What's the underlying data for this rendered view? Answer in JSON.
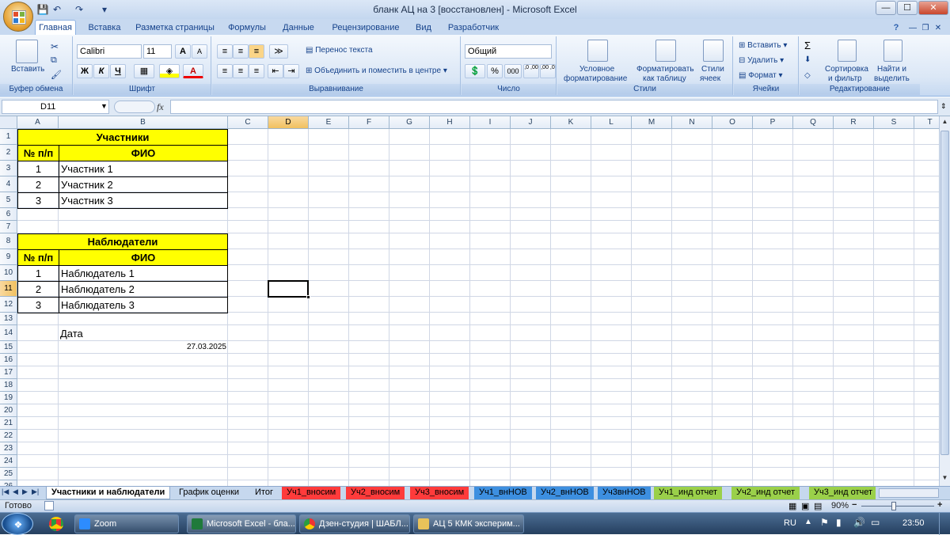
{
  "window": {
    "title": "бланк АЦ на 3 [восстановлен] - Microsoft Excel",
    "min": "—",
    "max": "☐",
    "close": "✕",
    "ribbon_min": "—",
    "ribbon_restore": "❐",
    "ribbon_close": "✕"
  },
  "tabs": [
    "Главная",
    "Вставка",
    "Разметка страницы",
    "Формулы",
    "Данные",
    "Рецензирование",
    "Вид",
    "Разработчик"
  ],
  "help_icon": "?",
  "ribbon": {
    "clipboard": {
      "paste": "Вставить",
      "label": "Буфер обмена"
    },
    "font": {
      "name": "Calibri",
      "size": "11",
      "bold": "Ж",
      "italic": "К",
      "underline": "Ч",
      "grow": "A",
      "shrink": "A",
      "color_letter": "A",
      "label": "Шрифт"
    },
    "alignment": {
      "wrap": "Перенос текста",
      "merge": "Объединить и поместить в центре",
      "label": "Выравнивание"
    },
    "number": {
      "format": "Общий",
      "percent": "%",
      "thousands": "000",
      "inc": ",0 ,00",
      "dec": ",00 ,0",
      "label": "Число"
    },
    "styles": {
      "conditional": "Условное",
      "conditional2": "форматирование",
      "table": "Форматировать",
      "table2": "как таблицу",
      "cell": "Стили",
      "cell2": "ячеек",
      "label": "Стили"
    },
    "cells": {
      "insert": "Вставить",
      "delete": "Удалить",
      "format": "Формат",
      "label": "Ячейки"
    },
    "editing": {
      "sigma": "Σ",
      "sort": "Сортировка",
      "sort2": "и фильтр",
      "find": "Найти и",
      "find2": "выделить",
      "label": "Редактирование"
    }
  },
  "formula_bar": {
    "name_box": "D11",
    "fx": "fx",
    "content": ""
  },
  "columns": [
    "A",
    "B",
    "C",
    "D",
    "E",
    "F",
    "G",
    "H",
    "I",
    "J",
    "K",
    "L",
    "M",
    "N",
    "O",
    "P",
    "Q",
    "R",
    "S",
    "T"
  ],
  "rows": [
    "1",
    "2",
    "3",
    "4",
    "5",
    "6",
    "7",
    "8",
    "9",
    "10",
    "11",
    "12",
    "13",
    "14",
    "15",
    "16",
    "17",
    "18",
    "19",
    "20",
    "21",
    "22",
    "23",
    "24",
    "25",
    "26"
  ],
  "cells": {
    "b1": "Участники",
    "a2": "№ п/п",
    "b2": "ФИО",
    "participants": [
      {
        "n": "1",
        "name": "Участник 1"
      },
      {
        "n": "2",
        "name": "Участник 2"
      },
      {
        "n": "3",
        "name": "Участник 3"
      }
    ],
    "b8": "Наблюдатели",
    "a9": "№ п/п",
    "b9": "ФИО",
    "observers": [
      {
        "n": "1",
        "name": "Наблюдатель 1"
      },
      {
        "n": "2",
        "name": "Наблюдатель 2"
      },
      {
        "n": "3",
        "name": "Наблюдатель 3"
      }
    ],
    "b14": "Дата",
    "b15": "27.03.2025"
  },
  "sheet_tabs": [
    {
      "label": "Участники и наблюдатели",
      "color": "#ffffff"
    },
    {
      "label": "График оценки",
      "color": "#c6d8ee"
    },
    {
      "label": "Итог",
      "color": "#c6d8ee"
    },
    {
      "label": "Уч1_вносим",
      "color": "#ff3b3b"
    },
    {
      "label": "Уч2_вносим",
      "color": "#ff3b3b"
    },
    {
      "label": "Уч3_вносим",
      "color": "#ff3b3b"
    },
    {
      "label": "Уч1_внНОВ",
      "color": "#3d8fe0"
    },
    {
      "label": "Уч2_внНОВ",
      "color": "#3d8fe0"
    },
    {
      "label": "Уч3внНОВ",
      "color": "#3d8fe0"
    },
    {
      "label": "Уч1_инд отчет",
      "color": "#9ad04a"
    },
    {
      "label": "Уч2_инд отчет",
      "color": "#9ad04a"
    },
    {
      "label": "Уч3_инд отчет",
      "color": "#9ad04a"
    }
  ],
  "status": {
    "ready": "Готово",
    "zoom": "90%",
    "minus": "−",
    "plus": "+"
  },
  "taskbar": {
    "items": [
      "Zoom",
      "Microsoft Excel - бла...",
      "Дзен-студия | ШАБЛ...",
      "АЦ 5 КМК эксперим..."
    ],
    "lang": "RU",
    "time": "23:50"
  }
}
